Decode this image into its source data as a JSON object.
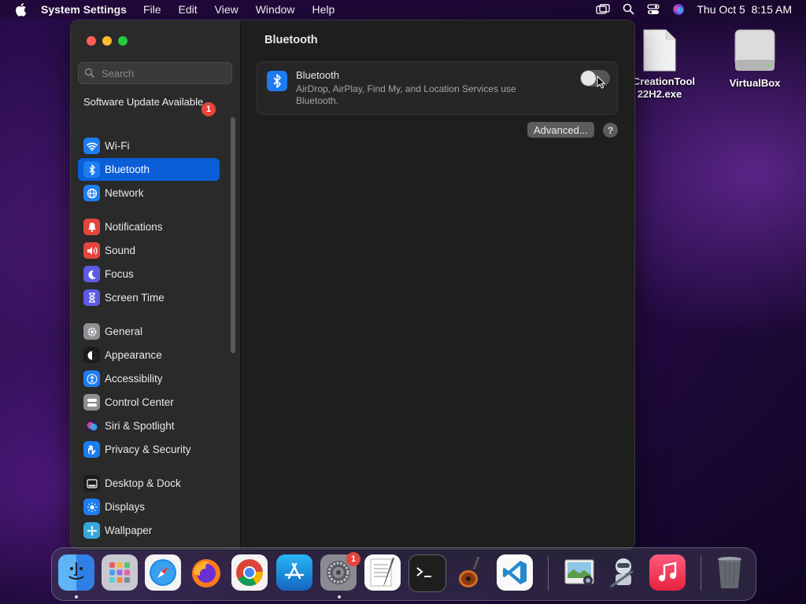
{
  "menubar": {
    "app_name": "System Settings",
    "menus": [
      "File",
      "Edit",
      "View",
      "Window",
      "Help"
    ],
    "clock": "Thu Oct 5  8:15 AM"
  },
  "desktop": {
    "items": [
      {
        "label": "iaCreationTool\n22H2.exe",
        "icon": "document-icon"
      },
      {
        "label": "VirtualBox",
        "icon": "drive-icon"
      }
    ]
  },
  "window": {
    "search_placeholder": "Search",
    "software_update": {
      "label": "Software Update Available",
      "badge": "1"
    },
    "sidebar": {
      "selected": "Bluetooth",
      "items": [
        {
          "label": "Wi-Fi",
          "icon": "wifi-icon",
          "color": "#1c7cf0"
        },
        {
          "label": "Bluetooth",
          "icon": "bluetooth-icon",
          "color": "#1c7cf0"
        },
        {
          "label": "Network",
          "icon": "globe-icon",
          "color": "#1c7cf0"
        },
        {
          "label": "Notifications",
          "icon": "bell-icon",
          "color": "#e5453c"
        },
        {
          "label": "Sound",
          "icon": "speaker-icon",
          "color": "#e5453c"
        },
        {
          "label": "Focus",
          "icon": "moon-icon",
          "color": "#5e5ce6"
        },
        {
          "label": "Screen Time",
          "icon": "hourglass-icon",
          "color": "#5e5ce6"
        },
        {
          "label": "General",
          "icon": "gear-icon",
          "color": "#8e8e93"
        },
        {
          "label": "Appearance",
          "icon": "appearance-icon",
          "color": "#1c1c1e"
        },
        {
          "label": "Accessibility",
          "icon": "accessibility-icon",
          "color": "#1c7cf0"
        },
        {
          "label": "Control Center",
          "icon": "control-center-icon",
          "color": "#8e8e93"
        },
        {
          "label": "Siri & Spotlight",
          "icon": "siri-icon",
          "color": "#2a2a2a"
        },
        {
          "label": "Privacy & Security",
          "icon": "hand-icon",
          "color": "#1c7cf0"
        },
        {
          "label": "Desktop & Dock",
          "icon": "dock-icon",
          "color": "#1c1c1e"
        },
        {
          "label": "Displays",
          "icon": "sun-icon",
          "color": "#1c7cf0"
        },
        {
          "label": "Wallpaper",
          "icon": "wallpaper-icon",
          "color": "#35a7d8"
        }
      ]
    },
    "content": {
      "title": "Bluetooth",
      "card_title": "Bluetooth",
      "card_desc": "AirDrop, AirPlay, Find My, and Location Services use Bluetooth.",
      "toggle_on": false,
      "advanced_button": "Advanced...",
      "help_button": "?"
    }
  },
  "dock": {
    "apps": [
      {
        "name": "Finder",
        "icon": "finder-icon",
        "running": true
      },
      {
        "name": "Launchpad",
        "icon": "launchpad-icon",
        "running": false
      },
      {
        "name": "Safari",
        "icon": "safari-icon",
        "running": false
      },
      {
        "name": "Firefox",
        "icon": "firefox-icon",
        "running": false
      },
      {
        "name": "Chrome",
        "icon": "chrome-icon",
        "running": false
      },
      {
        "name": "App Store",
        "icon": "app-store-icon",
        "running": false
      },
      {
        "name": "System Settings",
        "icon": "system-settings-icon",
        "running": true,
        "badge": "1"
      },
      {
        "name": "TextEdit",
        "icon": "textedit-icon",
        "running": false
      },
      {
        "name": "Terminal",
        "icon": "terminal-icon",
        "running": false
      },
      {
        "name": "GarageBand",
        "icon": "garageband-icon",
        "running": false
      },
      {
        "name": "Visual Studio Code",
        "icon": "vscode-icon",
        "running": false
      },
      {
        "name": "Preview",
        "icon": "preview-icon",
        "running": false
      },
      {
        "name": "Automator",
        "icon": "automator-icon",
        "running": false
      },
      {
        "name": "Music",
        "icon": "music-icon",
        "running": false
      },
      {
        "name": "Trash",
        "icon": "trash-icon",
        "running": false
      }
    ]
  }
}
